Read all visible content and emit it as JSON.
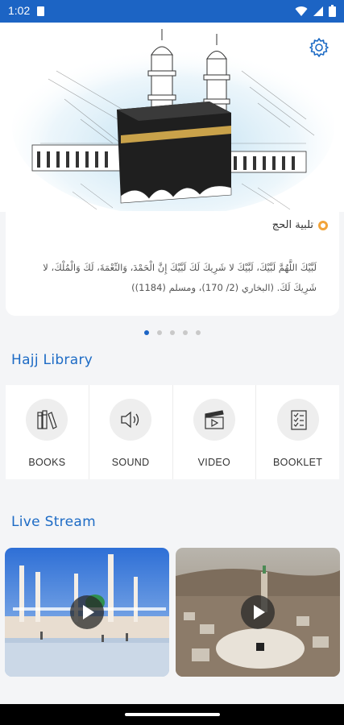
{
  "status_bar": {
    "time": "1:02",
    "icons": [
      "sim-card-icon",
      "wifi-icon",
      "signal-icon",
      "battery-icon"
    ]
  },
  "header": {
    "settings_icon": "gear-icon"
  },
  "talbiyah_card": {
    "title": "تلبية الحج",
    "text": "لَبَّيْكَ اللَّهُمَّ لَبَّيْكَ، لَبَّيْكَ لا شَرِيكَ لَكَ لَبَّيْكَ إِنَّ الْحَمْدَ، وَالنِّعْمَةَ، لَكَ وَالْمُلْكَ، لا شَرِيكَ لَكَ. (البخاري (2/ 170)، ومسلم (1184))"
  },
  "carousel": {
    "count": 5,
    "active": 0
  },
  "hajj_library": {
    "title": "Hajj Library",
    "items": [
      {
        "label": "BOOKS",
        "icon": "books-icon"
      },
      {
        "label": "SOUND",
        "icon": "speaker-icon"
      },
      {
        "label": "VIDEO",
        "icon": "clapperboard-icon"
      },
      {
        "label": "BOOKLET",
        "icon": "checklist-icon"
      }
    ]
  },
  "live_stream": {
    "title": "Live Stream",
    "streams": [
      {
        "name": "madinah-stream",
        "icon": "play-icon"
      },
      {
        "name": "makkah-stream",
        "icon": "play-icon"
      }
    ]
  },
  "colors": {
    "primary": "#1c64c4",
    "accent": "#f2a43a",
    "background": "#f4f5f7"
  }
}
